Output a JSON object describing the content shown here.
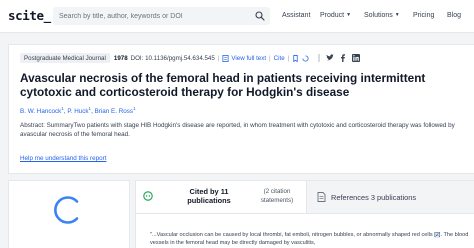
{
  "header": {
    "logo": "scite_",
    "search_placeholder": "Search by title, author, keywords or DOI",
    "nav": {
      "assistant": "Assistant",
      "product": "Product",
      "solutions": "Solutions",
      "pricing": "Pricing",
      "blog": "Blog"
    }
  },
  "article": {
    "journal": "Postgraduate Medical Journal",
    "year": "1978",
    "doi": "DOI: 10.1136/pgmj.54.634.545",
    "links": {
      "view_full_text": "View full text",
      "cite": "Cite"
    },
    "title": "Avascular necrosis of the femoral head in patients receiving intermittent cytotoxic and corticosteroid therapy for Hodgkin's disease",
    "authors": [
      {
        "name": "B. W. Hancock",
        "sup": "1"
      },
      {
        "name": "P. Huck",
        "sup": "1"
      },
      {
        "name": "Brian E. Ross",
        "sup": "1"
      }
    ],
    "abstract": "Abstract: SummaryTwo patients with stage HIB Hodgkin's disease are reported, in whom treatment with cytotoxic and corticosteroid therapy was followed by avascular necrosis of the femoral head.",
    "help_link": "Help me understand this report"
  },
  "citations": {
    "tab_cited": "Cited by 11 publications",
    "statements": "(2 citation statements)",
    "tab_refs": "References 3 publications",
    "snippet_pre": "\"...Vascular occlusion can be caused by local thrombi, fat emboli, nitrogen bubbles, or abnormally shaped red cells ",
    "snippet_ref": "[2]",
    "snippet_post": ". The blood vessels in the femoral head may be directly damaged by vasculitis,"
  },
  "colors": {
    "link": "#2563eb",
    "spinner": "#3b82f6",
    "cite_icon": "#16a34a"
  }
}
